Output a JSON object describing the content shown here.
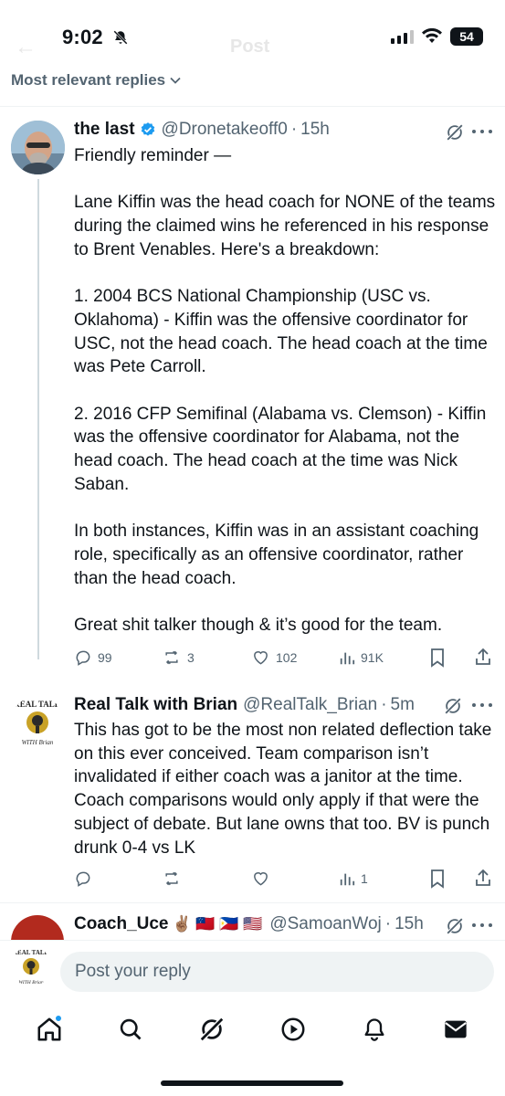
{
  "status": {
    "time": "9:02",
    "battery": "54"
  },
  "header": {
    "back_glyph": "←",
    "title": "Post"
  },
  "sort": {
    "label": "Most relevant replies"
  },
  "tweets": [
    {
      "name": "the last",
      "handle": "@Dronetakeoff0",
      "dot": "·",
      "time": "15h",
      "verified": true,
      "paragraphs": [
        "Friendly reminder —",
        "Lane Kiffin was the head coach for NONE of the teams during the claimed wins he referenced in his response to Brent Venables. Here's a breakdown:",
        "1. 2004 BCS National Championship (USC vs. Oklahoma) - Kiffin was the offensive coordinator for USC, not the head coach. The head coach at the time was Pete Carroll.",
        "2. 2016 CFP Semifinal (Alabama vs. Clemson) - Kiffin was the offensive coordinator for Alabama, not the head coach. The head coach at the time was Nick Saban.",
        "In both instances, Kiffin was in an assistant coaching role, specifically as an offensive coordinator, rather than the head coach.",
        "Great shit talker though & it’s good for the team."
      ],
      "stats": {
        "replies": "99",
        "reposts": "3",
        "likes": "102",
        "views": "91K"
      }
    },
    {
      "name": "Real Talk with Brian",
      "handle": "@RealTalk_Brian",
      "dot": "·",
      "time": "5m",
      "verified": false,
      "avatar_text_top": "REAL TALK",
      "avatar_text_bottom": "WITH Brian",
      "paragraphs": [
        "This has got to be the most non related deflection take on this ever conceived. Team comparison isn’t invalidated if either coach was a janitor at the time. Coach comparisons would only apply if that were the subject of debate. But lane owns that too. BV is punch drunk 0-4 vs LK"
      ],
      "stats": {
        "replies": "",
        "reposts": "",
        "likes": "",
        "views": "1"
      }
    },
    {
      "name": "Coach_Uce",
      "emoji": "✌🏽 🇼🇸 🇵🇭 🇺🇸",
      "handle": "@SamoanWoj",
      "dot": "·",
      "time": "15h"
    }
  ],
  "reply_bar": {
    "placeholder": "Post your reply"
  },
  "nav": {
    "items": [
      "home-icon",
      "search-icon",
      "grok-icon",
      "video-icon",
      "notifications-icon",
      "messages-icon"
    ],
    "accent": "#1d9bf0"
  },
  "colors": {
    "text": "#0f1419",
    "muted": "#536471",
    "accent": "#1d9bf0",
    "divider": "#eff3f4"
  }
}
